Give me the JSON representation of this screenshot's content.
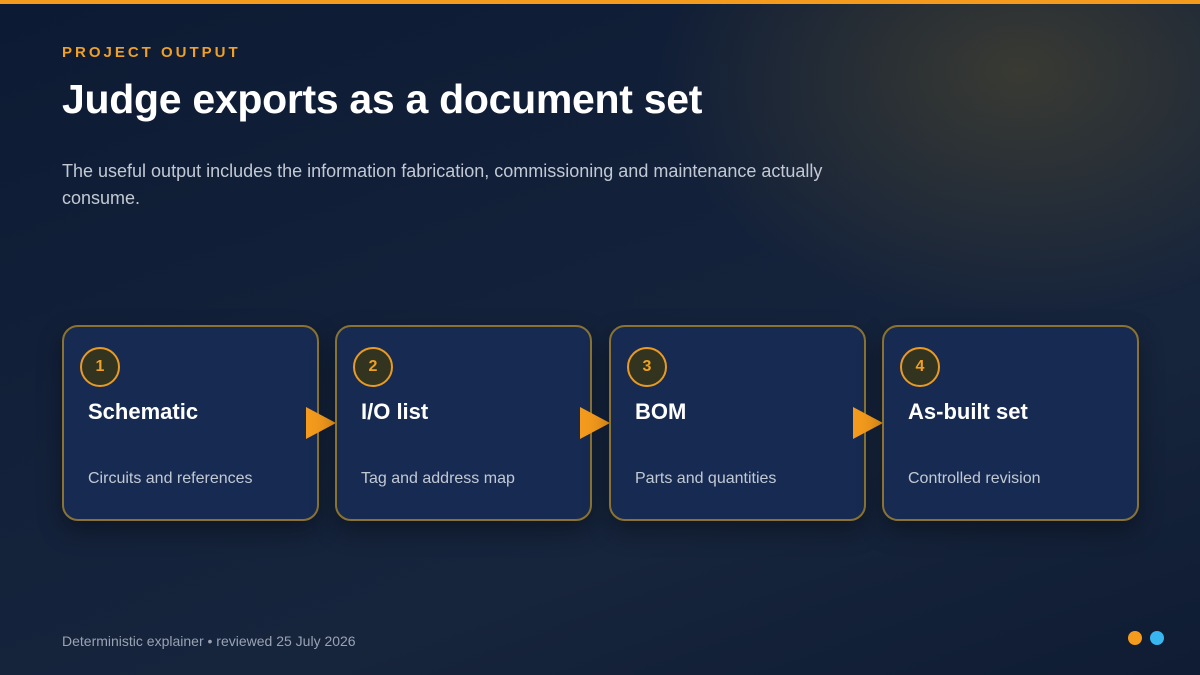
{
  "header": {
    "eyebrow": "PROJECT OUTPUT",
    "title": "Judge exports as a document set",
    "subtitle": "The useful output includes the information fabrication, commissioning and maintenance actually consume."
  },
  "steps": [
    {
      "number": "1",
      "title": "Schematic",
      "description": "Circuits and references"
    },
    {
      "number": "2",
      "title": "I/O list",
      "description": "Tag and address map"
    },
    {
      "number": "3",
      "title": "BOM",
      "description": "Parts and quantities"
    },
    {
      "number": "4",
      "title": "As-built set",
      "description": "Controlled revision"
    }
  ],
  "footer": {
    "text": "Deterministic explainer • reviewed 25 July 2026"
  },
  "colors": {
    "accent": "#f49b1d",
    "secondary": "#38b6f0",
    "card_background": "#172b52"
  }
}
